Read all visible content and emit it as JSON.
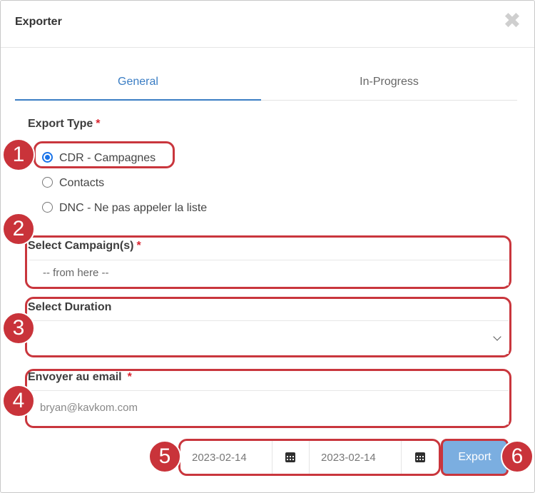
{
  "dialog": {
    "title": "Exporter",
    "close_icon": "close-icon"
  },
  "tabs": [
    {
      "label": "General",
      "active": true
    },
    {
      "label": "In-Progress",
      "active": false
    }
  ],
  "export_type": {
    "label": "Export Type",
    "required_mark": "*",
    "options": [
      {
        "label": "CDR - Campagnes",
        "checked": true
      },
      {
        "label": "Contacts",
        "checked": false
      },
      {
        "label": "DNC - Ne pas appeler la liste",
        "checked": false
      }
    ]
  },
  "campaign": {
    "label": "Select Campaign(s)",
    "required_mark": "*",
    "placeholder": "-- from here --"
  },
  "duration": {
    "label": "Select Duration",
    "value": ""
  },
  "email": {
    "label": "Envoyer au email",
    "required_mark": "*",
    "placeholder": "bryan@kavkom.com"
  },
  "date_range": {
    "start": "2023-02-14",
    "end": "2023-02-14",
    "calendar_icon": "calendar-icon"
  },
  "export_button": "Export",
  "annotations": [
    "1",
    "2",
    "3",
    "4",
    "5",
    "6"
  ],
  "colors": {
    "accent": "#3a7dc4",
    "highlight": "#c9363d",
    "button": "#7baee0"
  }
}
